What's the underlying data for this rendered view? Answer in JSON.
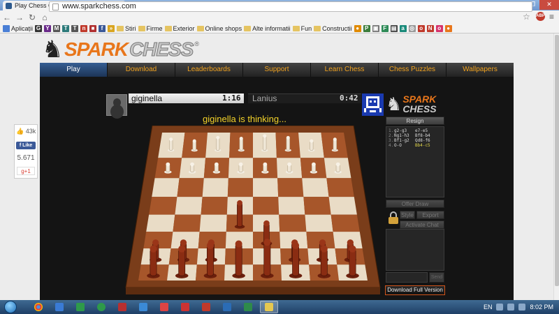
{
  "browser": {
    "tab_title": "Play Chess Online - The P",
    "tab_close": "×",
    "url": "www.sparkchess.com",
    "bookmarks": [
      "Aplicații",
      "Stiri",
      "Firme",
      "Exterior",
      "Online shops",
      "Alte informatii",
      "Fun",
      "Constructii"
    ],
    "ext_badge": "ABP",
    "icons": {
      "back": "back-arrow-icon",
      "forward": "forward-arrow-icon",
      "reload": "reload-icon",
      "home": "home-icon",
      "star": "star-icon",
      "menu": "hamburger-menu-icon"
    }
  },
  "site": {
    "logo_spark": "SPARK",
    "logo_chess": "CHESS",
    "logo_reg": "®",
    "nav": [
      "Play",
      "Download",
      "Leaderboards",
      "Support",
      "Learn Chess",
      "Chess Puzzles",
      "Wallpapers"
    ],
    "active_nav": "Play"
  },
  "social": {
    "likes": "43k",
    "like_label": "Like",
    "shares": "5.671",
    "gplus": "g+1"
  },
  "game": {
    "player1": {
      "name": "giginella",
      "clock": "1:16"
    },
    "player2": {
      "name": "Lanius",
      "clock": "0:42"
    },
    "status": "giginella is thinking...",
    "brand_spark": "SPARK",
    "brand_chess": "CHESS",
    "resign": "Resign",
    "offer_draw": "Offer Draw",
    "style": "Style",
    "export_pgn": "Export PGN",
    "activate_chat": "Activate Chat",
    "send": "Send",
    "download_full": "Download Full Version",
    "moves": [
      {
        "n": "1.",
        "white": "g2-g3",
        "black": "e7-e5"
      },
      {
        "n": "2.",
        "white": "Ng1-h3",
        "black": "Bf8-b4"
      },
      {
        "n": "3.",
        "white": "Bf1-g2",
        "black": "Qd8-f6"
      },
      {
        "n": "4.",
        "white": "O-O",
        "black": "Bb4-c5"
      }
    ],
    "colors": {
      "accent_orange": "#e8761b",
      "nav_text": "#f1a21e",
      "status_yellow": "#f4d32a",
      "highlight_move": "#e2d64a"
    }
  },
  "taskbar": {
    "lang": "EN",
    "time": "8:02 PM"
  }
}
